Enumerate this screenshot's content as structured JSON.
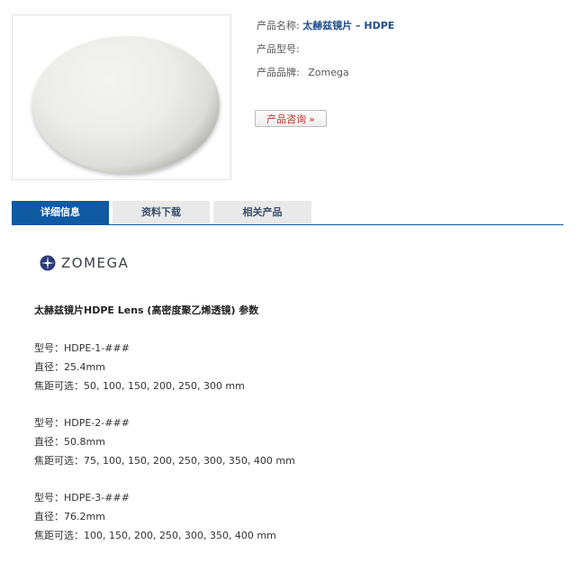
{
  "product": {
    "name_label": "产品名称:",
    "name_value": "太赫兹镜片 – HDPE",
    "model_label": "产品型号:",
    "model_value": "",
    "brand_label": "产品品牌:",
    "brand_value": "Zomega",
    "consult_label": "产品咨询",
    "consult_arrow": "»"
  },
  "tabs": [
    {
      "label": "详细信息",
      "active": true
    },
    {
      "label": "资料下载",
      "active": false
    },
    {
      "label": "相关产品",
      "active": false
    }
  ],
  "logo": {
    "text": "ZOMEGA"
  },
  "details": {
    "heading": "太赫兹镜片HDPE Lens (高密度聚乙烯透镜) 参数",
    "specs": [
      {
        "model": "型号：HDPE-1-###",
        "diameter": "直径：25.4mm",
        "focal": "焦距可选：50, 100, 150, 200, 250, 300 mm"
      },
      {
        "model": "型号：HDPE-2-###",
        "diameter": "直径：50.8mm",
        "focal": "焦距可选：75, 100, 150, 200, 250, 300, 350, 400 mm"
      },
      {
        "model": "型号：HDPE-3-###",
        "diameter": "直径：76.2mm",
        "focal": "焦距可选：100, 150, 200, 250, 300, 350, 400 mm"
      }
    ]
  },
  "colors": {
    "accent": "#0f5aa2",
    "product_name": "#1c4e8b",
    "consult_text": "#c0302a",
    "tab_inactive_bg": "#e9e9e9"
  }
}
